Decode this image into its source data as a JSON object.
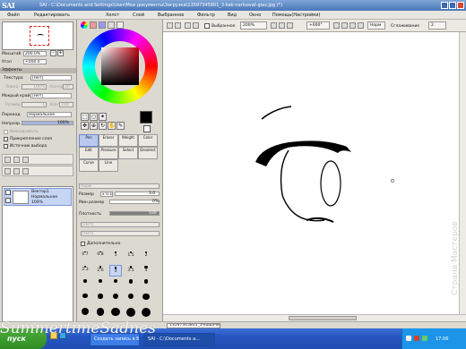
{
  "app": {
    "logo": "SAI",
    "title": "SAI - C:\\Documents and Settings\\User\\Мои документы\\Загрузки\\13597345801_3-kak-narisovat-glaz.jpg (*)"
  },
  "menu": [
    "Файл",
    "Редактировать",
    "Холст",
    "Слой",
    "Выбранное",
    "Фильтр",
    "Вид",
    "Окно",
    "Помощь(Настройки)"
  ],
  "toolbar": {
    "checkbox_label": "Выбранное",
    "zoom": "200%",
    "angle": "+000°",
    "mode": "Норм",
    "smoothing_label": "Сглаживание",
    "smoothing": "2"
  },
  "nav": {
    "zoom_label": "Масштаб",
    "zoom": "200.0%",
    "angle_label": "Угол",
    "angle": "+000.0"
  },
  "effects": {
    "header": "Эффекты",
    "texture_label": "Текстура",
    "texture": "[Нет]",
    "scale_label": "Зерно",
    "scale": "100%",
    "strength_label": "Контр",
    "strength": "20",
    "edge_label": "Мокрый край",
    "edge": "[Нет]",
    "width_label": "Размер",
    "width": "1",
    "intensity_label": "Контр",
    "intensity": "100"
  },
  "layer": {
    "blend_label": "Переход",
    "blend": "Нормальное",
    "opacity_label": "Непрозр.",
    "opacity": "100%",
    "opacity_fraction": 1.0,
    "opts": [
      "Фиксировать",
      "Прикрепление слоя",
      "Источник выбора"
    ],
    "name": "Вектор1",
    "mode": "Нормальное",
    "pct": "100%"
  },
  "tools": {
    "row1": [
      "Pen",
      "Eraser",
      "Weight",
      "Color"
    ],
    "row2": [
      "Edit",
      "Pressure",
      "Select",
      "Deselect"
    ],
    "row3": [
      "Curve",
      "Line"
    ]
  },
  "brush": {
    "mode": "Норм",
    "size_label": "Размер",
    "size_mult": "x 0.1",
    "size": "3.0",
    "min_label": "Мин размер",
    "min": "0%",
    "density_label": "Плотность",
    "density": "100",
    "density_fraction": 1.0,
    "none1": "[Нет]",
    "none2": "[Нет]",
    "adv_label": "Дополнительно",
    "sizes": [
      [
        "0.7",
        "0.8",
        "1",
        "1.5",
        "2"
      ],
      [
        "2.3",
        "2.6",
        "3",
        "3.5",
        "4"
      ],
      [
        "5",
        "6",
        "7",
        "8",
        "9"
      ],
      [
        "10",
        "12",
        "14",
        "16",
        "20"
      ],
      [
        "25",
        "30",
        "35",
        "40",
        "50"
      ]
    ]
  },
  "taskbar": {
    "start": "пуск",
    "tasks": [
      "13597345801_3-koшачи...",
      "Создать запись в Бл...",
      "SAI - C:\\Documents a..."
    ],
    "clock": "17:06"
  },
  "watermarks": {
    "signature": "SummertimeSadnes",
    "site": "Страна Мастеров"
  },
  "colors": {
    "taskbar": "#2556c0",
    "title": "#4a77b8",
    "selection": "#b9c9ef"
  }
}
